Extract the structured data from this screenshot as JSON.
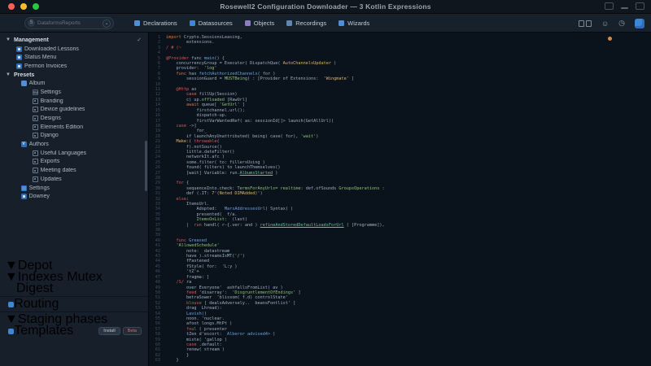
{
  "window": {
    "title": "Rosewell2 Configuration Downloader — 3 Kotlin Expressions",
    "traffic_lights": [
      "#ff5f57",
      "#febc2e",
      "#28c840"
    ]
  },
  "toolbar": {
    "search": {
      "badge": "S",
      "text": "DataformsReports",
      "drop_glyph": "⌄"
    },
    "tabs": [
      {
        "label": "Declarations",
        "color": "#4f8fd6"
      },
      {
        "label": "Datasources",
        "color": "#3e86d8"
      },
      {
        "label": "Objects",
        "color": "#8e7cc3"
      },
      {
        "label": "Recordings",
        "color": "#5f87b0"
      },
      {
        "label": "Wizards",
        "color": "#4f8fd6"
      }
    ],
    "right_icons": {
      "user": "user-icon",
      "clock": "clock-icon",
      "avatar": "avatar"
    }
  },
  "sidebar": {
    "tree_top": [
      {
        "type": "header",
        "label": "Management",
        "level": 0,
        "trailing": "✓"
      },
      {
        "type": "item",
        "label": "Downloaded Lessons",
        "level": 1,
        "icon": "doc-icon"
      },
      {
        "type": "item",
        "label": "Status Menu",
        "level": 1,
        "icon": "doc-icon"
      },
      {
        "type": "item",
        "label": "Permon Invoices",
        "level": 1,
        "icon": "doc-icon"
      },
      {
        "type": "header",
        "label": "Presets",
        "level": 0
      },
      {
        "type": "item",
        "label": "Album",
        "level": 1.4,
        "icon": "folder-icon"
      },
      {
        "type": "item",
        "label": "Settings",
        "level": 2.4,
        "icon": "sw-badge",
        "icon_text": "SW"
      },
      {
        "type": "item",
        "label": "Branding",
        "level": 2.4,
        "icon": "square-icon"
      },
      {
        "type": "item",
        "label": "Device guidelines",
        "level": 2.4,
        "icon": "square-icon"
      },
      {
        "type": "item",
        "label": "Designs",
        "level": 2.4,
        "icon": "square-icon"
      },
      {
        "type": "item",
        "label": "Elements Edition",
        "level": 2.4,
        "icon": "square-icon"
      },
      {
        "type": "item",
        "label": "Django",
        "level": 2.4,
        "icon": "square-icon"
      },
      {
        "type": "item",
        "label": "Authors",
        "level": 1.4,
        "icon": "v-icon",
        "icon_text": "V"
      },
      {
        "type": "item",
        "label": "Useful Languages",
        "level": 2.4,
        "icon": "square-icon"
      },
      {
        "type": "item",
        "label": "Exports",
        "level": 2.4,
        "icon": "square-icon"
      },
      {
        "type": "item",
        "label": "Meeting dates",
        "level": 2.4,
        "icon": "square-icon"
      },
      {
        "type": "item",
        "label": "Updates",
        "level": 2.4,
        "icon": "square-icon"
      },
      {
        "type": "item",
        "label": "Settings",
        "level": 1.4,
        "icon": "grid-icon"
      },
      {
        "type": "item",
        "label": "Downey",
        "level": 1.4,
        "icon": "doc-icon"
      }
    ],
    "tree_bottom": [
      {
        "type": "header",
        "label": "Depot",
        "level": 0
      },
      {
        "type": "header",
        "label": "Indexes Mutex",
        "level": 0
      },
      {
        "type": "item",
        "label": "Digest",
        "level": 1
      },
      {
        "type": "divider"
      },
      {
        "type": "item",
        "label": "Routing",
        "level": 0.3,
        "icon": "dot-icon"
      },
      {
        "type": "divider"
      },
      {
        "type": "header",
        "label": "Staging phases",
        "level": 0
      },
      {
        "type": "item",
        "label": "Templates",
        "level": 0.3,
        "icon": "dot-icon",
        "buttons": [
          {
            "label": "Install",
            "red": false
          },
          {
            "label": "Beta",
            "red": true
          }
        ]
      }
    ]
  },
  "editor": {
    "lines": [
      [
        [
          "k",
          "import "
        ],
        [
          "d",
          "Crypto.SessionsLeasing,"
        ]
      ],
      [
        [
          "d",
          "        extensions."
        ]
      ],
      [
        [
          "r",
          "/ # (~"
        ]
      ],
      [],
      [
        [
          "r",
          "@Provider"
        ],
        [
          "d",
          " func "
        ],
        [
          "b",
          "main"
        ],
        [
          "d",
          "() {"
        ]
      ],
      [
        [
          "d",
          "    concurrencyGroup = Executor( DispatchQue( "
        ],
        [
          "y",
          "AutoChannelsUpdater"
        ],
        [
          "d",
          " )"
        ]
      ],
      [
        [
          "d",
          "    provider:  "
        ],
        [
          "s",
          "'log'"
        ]
      ],
      [
        [
          "k",
          "    func "
        ],
        [
          "d",
          "has "
        ],
        [
          "b",
          "fetchAuthorizedChannels"
        ],
        [
          "d",
          "( for )"
        ]
      ],
      [
        [
          "d",
          "        sessionGuard = "
        ],
        [
          "s",
          "MUSTBeing"
        ],
        [
          "d",
          "( : [Provider of Extensions:  "
        ],
        [
          "y",
          "'Wingmate'"
        ],
        [
          "d",
          " ]"
        ]
      ],
      [],
      [
        [
          "r",
          "    @Http"
        ],
        [
          "d",
          " as"
        ]
      ],
      [
        [
          "k",
          "        case "
        ],
        [
          "d",
          "fillUp(Session)"
        ]
      ],
      [
        [
          "d",
          "        c) up."
        ],
        [
          "s",
          "offloaded "
        ],
        [
          "d",
          "[RawUrl]"
        ]
      ],
      [
        [
          "k",
          "        await "
        ],
        [
          "d",
          "queue[ "
        ],
        [
          "s",
          "'GetUrl'"
        ],
        [
          "d",
          " ]"
        ]
      ],
      [
        [
          "d",
          "            firstchannel.url();"
        ]
      ],
      [
        [
          "d",
          "            dispatch-up."
        ]
      ],
      [
        [
          "d",
          "            firstVarWantedRef( as: sessionId[]> launch(GetAllUrl))"
        ]
      ],
      [
        [
          "r",
          "    case"
        ],
        [
          "d",
          " ->]"
        ]
      ],
      [
        [
          "d",
          "            for_"
        ]
      ],
      [
        [
          "d",
          "        if launchAnyUnattributed( being) case( for), "
        ],
        [
          "s",
          "'wait')"
        ]
      ],
      [
        [
          "y",
          "    Make:( "
        ],
        [
          "r",
          "throwable"
        ],
        [
          "d",
          "("
        ]
      ],
      [
        [
          "d",
          "        f).notSource()"
        ]
      ],
      [
        [
          "d",
          "        little.dateFilter()"
        ]
      ],
      [
        [
          "d",
          "        networkIt.afc )"
        ]
      ],
      [
        [
          "d",
          "        some.filter( to: fillersUsing )"
        ]
      ],
      [
        [
          "d",
          "        found( filters) to launchThemselves()"
        ]
      ],
      [
        [
          "d",
          "        [wait] Variable: run."
        ],
        [
          "t",
          "AlbumsStarted"
        ],
        [
          "d",
          " )"
        ]
      ],
      [],
      [
        [
          "r",
          "    for"
        ],
        [
          "d",
          " {"
        ]
      ],
      [
        [
          "d",
          "        sequenceInto.check: "
        ],
        [
          "s",
          "TermsForAnyUrls= realtime:"
        ],
        [
          "d",
          " def.ofSounds "
        ],
        [
          "s",
          "GroupsOperations"
        ],
        [
          "d",
          " :"
        ]
      ],
      [
        [
          "d",
          "        def (.IT: "
        ],
        [
          "y",
          "7'(Noted DIMAdded)'"
        ],
        [
          "d",
          ")"
        ]
      ],
      [
        [
          "r",
          "    else"
        ],
        [
          "d",
          ":"
        ]
      ],
      [
        [
          "d",
          "        ItemsUrl."
        ]
      ],
      [
        [
          "d",
          "            Adopted:   "
        ],
        [
          "b",
          "MarsAddressesUrl"
        ],
        [
          "d",
          "( Syntax) )"
        ]
      ],
      [
        [
          "d",
          "            presented(  f/a."
        ]
      ],
      [
        [
          "d",
          "            "
        ],
        [
          "s",
          "ItemsOnList:"
        ],
        [
          "d",
          "  (last)"
        ]
      ],
      [
        [
          "d",
          "        |  "
        ],
        [
          "r",
          "run"
        ],
        [
          "d",
          " handl( r-{.ver: and ) "
        ],
        [
          "t",
          "refineAndStoredDefaultLoadsForUrl"
        ],
        [
          "d",
          " ( [Programme]),"
        ]
      ],
      [],
      [],
      [
        [
          "r",
          "    func "
        ],
        [
          "b",
          "Greased"
        ]
      ],
      [
        [
          "s",
          "    'AllowedSchedule'"
        ]
      ],
      [
        [
          "d",
          "        note:  datastream"
        ]
      ],
      [
        [
          "d",
          "        have ).streamsIsMT("
        ],
        [
          "s",
          "'/'"
        ],
        [
          "d",
          ")"
        ]
      ],
      [
        [
          "d",
          "        fFastened"
        ]
      ],
      [
        [
          "d",
          "        fStyle( for:  'L:y )"
        ]
      ],
      [
        [
          "d",
          "        'tZ'+"
        ]
      ],
      [
        [
          "d",
          "        fragma: ]"
        ]
      ],
      [
        [
          "r",
          "    /S/"
        ],
        [
          "d",
          " ra"
        ]
      ],
      [
        [
          "d",
          "        over Everyone'  ashfallsFromList( av )"
        ]
      ],
      [
        [
          "r",
          "        feed"
        ],
        [
          "d",
          " 'disarray':  "
        ],
        [
          "s",
          "'DisgruntlementOfEndings'"
        ],
        [
          "d",
          " ]"
        ]
      ],
      [
        [
          "d",
          "        betraSower  'blissom( f.d) controlState'"
        ]
      ],
      [
        [
          "r",
          "        blouse"
        ],
        [
          "d",
          " [ dealsAdversely..  beansFontlist' ]"
        ]
      ],
      [
        [
          "d",
          "        drag  Lhread):"
        ]
      ],
      [
        [
          "b",
          "        Lavish("
        ],
        [
          "d",
          ")"
        ]
      ],
      [
        [
          "d",
          "        noon. 'nuclear."
        ]
      ],
      [
        [
          "d",
          "        afoot longs.MtPt )"
        ]
      ],
      [
        [
          "r",
          "        foul"
        ],
        [
          "d",
          " ( presenter"
        ]
      ],
      [
        [
          "d",
          "        tZen d'escort:  "
        ],
        [
          "b",
          "Alberor advised4>"
        ],
        [
          "d",
          " )"
        ]
      ],
      [
        [
          "d",
          "        miste( 'gallop )"
        ]
      ],
      [
        [
          "r",
          "        case"
        ],
        [
          "d",
          " .default:"
        ]
      ],
      [
        [
          "d",
          "        renew( stream )"
        ]
      ],
      [
        [
          "d",
          "        }"
        ]
      ],
      [
        [
          "d",
          "    }"
        ]
      ]
    ]
  }
}
